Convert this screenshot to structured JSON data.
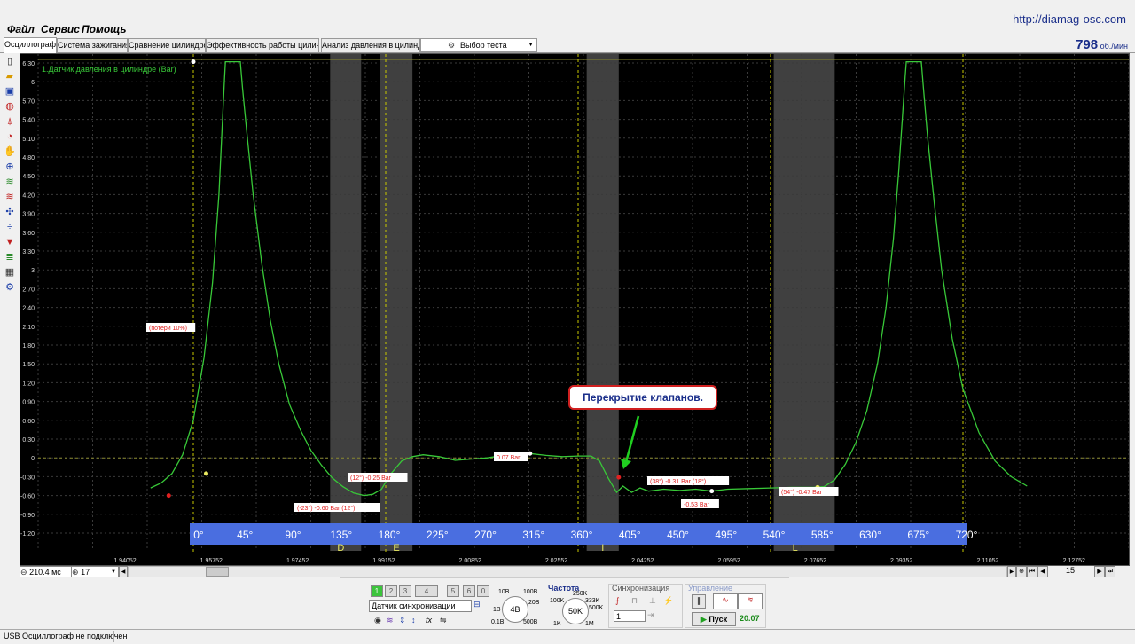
{
  "menu": {
    "items": [
      "Файл",
      "Сервис",
      "Помощь"
    ]
  },
  "site_url": "http://diamag-osc.com",
  "tabs": [
    "Осциллограф",
    "Система зажигания",
    "Сравнение цилиндров",
    "Эффективность работы цилиндров",
    "Анализ давления в цилиндре"
  ],
  "active_tab": 0,
  "test_select": {
    "label": "Выбор теста"
  },
  "rpm": {
    "value": "798",
    "unit": "об./мин"
  },
  "scope": {
    "channel_label": "1.Датчик давления в цилиндре (Bar)",
    "y_ticks": [
      "6.30",
      "6",
      "5.70",
      "5.40",
      "5.10",
      "4.80",
      "4.50",
      "4.20",
      "3.90",
      "3.60",
      "3.30",
      "3",
      "2.70",
      "2.40",
      "2.10",
      "1.80",
      "1.50",
      "1.20",
      "0.90",
      "0.60",
      "0.30",
      "0",
      "-0.30",
      "-0.60",
      "-0.90",
      "-1.20"
    ],
    "y_tick_values": [
      6.3,
      6.0,
      5.7,
      5.4,
      5.1,
      4.8,
      4.5,
      4.2,
      3.9,
      3.6,
      3.3,
      3.0,
      2.7,
      2.4,
      2.1,
      1.8,
      1.5,
      1.2,
      0.9,
      0.6,
      0.3,
      0,
      -0.3,
      -0.6,
      -0.9,
      -1.2
    ],
    "time_ticks": [
      "1.94052",
      "1.95752",
      "1.97452",
      "1.99152",
      "2.00852",
      "2.02552",
      "2.04252",
      "2.05952",
      "2.07652",
      "2.09352",
      "2.11052",
      "2.12752"
    ],
    "degree_labels": [
      "0°",
      "45°",
      "90°",
      "135°",
      "180°",
      "225°",
      "270°",
      "315°",
      "360°",
      "405°",
      "450°",
      "495°",
      "540°",
      "585°",
      "630°",
      "675°",
      "720°"
    ],
    "degree_values": [
      0,
      45,
      90,
      135,
      180,
      225,
      270,
      315,
      360,
      405,
      450,
      495,
      540,
      585,
      630,
      675,
      720
    ],
    "zone_letters": [
      "D",
      "E",
      "I",
      "L"
    ],
    "callout": "Перекрытие клапанов.",
    "annotations": [
      "(потери 10%)",
      "(-23°) -0.60 Bar (12°)",
      "(12°) -0.25 Bar",
      "0.07 Bar",
      "(38°) -0.31 Bar (18°)",
      "-0.53 Bar",
      "(54°) -0.47 Bar"
    ],
    "colors": {
      "trace": "#38c838",
      "grid": "#3a3a3a",
      "marker": "#c8c800",
      "degree_band": "#4a6ee0",
      "zone": "#555555"
    }
  },
  "chart_data": {
    "type": "line",
    "x_unit": "degrees",
    "xlim": [
      -40,
      780
    ],
    "ylim": [
      -1.35,
      6.45
    ],
    "series": [
      {
        "name": "1.Датчик давления в цилиндре (Bar)",
        "points": [
          [
            -40,
            -0.48
          ],
          [
            -30,
            -0.4
          ],
          [
            -20,
            -0.25
          ],
          [
            -10,
            0.05
          ],
          [
            0,
            0.6
          ],
          [
            10,
            1.6
          ],
          [
            18,
            2.8
          ],
          [
            24,
            4.2
          ],
          [
            27,
            5.3
          ],
          [
            29,
            6.0
          ],
          [
            30,
            6.32
          ],
          [
            44,
            6.32
          ],
          [
            46,
            5.9
          ],
          [
            50,
            5.2
          ],
          [
            56,
            4.2
          ],
          [
            64,
            3.1
          ],
          [
            72,
            2.2
          ],
          [
            80,
            1.5
          ],
          [
            90,
            0.85
          ],
          [
            100,
            0.45
          ],
          [
            110,
            0.12
          ],
          [
            120,
            -0.12
          ],
          [
            130,
            -0.32
          ],
          [
            140,
            -0.46
          ],
          [
            150,
            -0.56
          ],
          [
            160,
            -0.6
          ],
          [
            168,
            -0.58
          ],
          [
            176,
            -0.5
          ],
          [
            185,
            -0.25
          ],
          [
            195,
            -0.05
          ],
          [
            205,
            0.02
          ],
          [
            215,
            0.05
          ],
          [
            230,
            0.02
          ],
          [
            245,
            -0.04
          ],
          [
            260,
            -0.02
          ],
          [
            275,
            0.0
          ],
          [
            290,
            0.04
          ],
          [
            305,
            0.06
          ],
          [
            315,
            0.07
          ],
          [
            330,
            0.04
          ],
          [
            345,
            0.02
          ],
          [
            360,
            0.03
          ],
          [
            372,
            0.03
          ],
          [
            380,
            -0.05
          ],
          [
            388,
            -0.32
          ],
          [
            396,
            -0.55
          ],
          [
            402,
            -0.45
          ],
          [
            410,
            -0.55
          ],
          [
            418,
            -0.48
          ],
          [
            426,
            -0.53
          ],
          [
            440,
            -0.5
          ],
          [
            455,
            -0.52
          ],
          [
            470,
            -0.5
          ],
          [
            485,
            -0.53
          ],
          [
            500,
            -0.5
          ],
          [
            520,
            -0.49
          ],
          [
            540,
            -0.48
          ],
          [
            560,
            -0.47
          ],
          [
            580,
            -0.47
          ],
          [
            590,
            -0.46
          ],
          [
            600,
            -0.35
          ],
          [
            610,
            -0.1
          ],
          [
            620,
            0.25
          ],
          [
            630,
            0.75
          ],
          [
            640,
            1.5
          ],
          [
            648,
            2.4
          ],
          [
            655,
            3.5
          ],
          [
            660,
            4.6
          ],
          [
            664,
            5.6
          ],
          [
            666,
            6.1
          ],
          [
            667,
            6.32
          ],
          [
            681,
            6.32
          ],
          [
            683,
            5.9
          ],
          [
            687,
            5.1
          ],
          [
            693,
            4.1
          ],
          [
            700,
            3.0
          ],
          [
            710,
            1.9
          ],
          [
            720,
            1.1
          ],
          [
            735,
            0.4
          ],
          [
            750,
            -0.05
          ],
          [
            765,
            -0.3
          ],
          [
            780,
            -0.45
          ]
        ]
      }
    ],
    "grid": true
  },
  "bottom": {
    "time_scale": "210.4 мс",
    "zoom_value": "17",
    "page_number": "15",
    "channel_tabs": [
      "1",
      "2",
      "3",
      "4",
      "5",
      "6",
      "0"
    ],
    "sensor_select": "Датчик синхронизации",
    "volt_knob": {
      "value": "4B",
      "labels": [
        "10B",
        "100B",
        "20B",
        "1B",
        "500B",
        "0.1B"
      ]
    },
    "freq": {
      "title": "Частота",
      "value": "50K",
      "labels": [
        "250K",
        "333K",
        "100K",
        "500K",
        "1K",
        "1M"
      ]
    },
    "sync": {
      "title": "Синхронизация",
      "select": "1"
    },
    "control": {
      "title": "Управление",
      "start": "Пуск",
      "counter": "20.07"
    }
  },
  "status": {
    "text": "USB Осциллограф не подключен"
  }
}
